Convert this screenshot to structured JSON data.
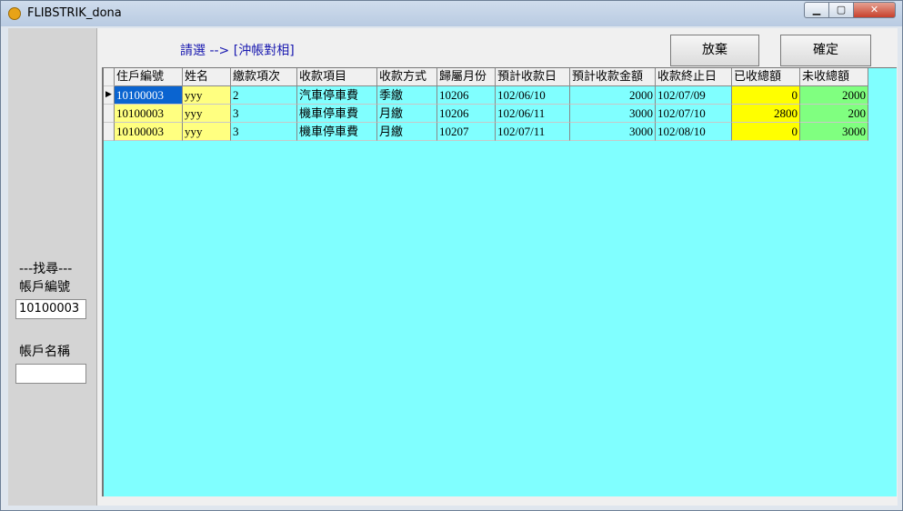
{
  "window": {
    "title": "FLIBSTRIK_dona",
    "min_glyph": "▁",
    "max_glyph": "▢",
    "close_glyph": "✕"
  },
  "search": {
    "heading": "---找尋---",
    "account_no_label": "帳戶編號",
    "account_no_value": "10100003",
    "account_name_label": "帳戶名稱",
    "account_name_value": ""
  },
  "main": {
    "prompt": "請選 --> [沖帳對相]",
    "cancel_label": "放棄",
    "confirm_label": "確定"
  },
  "grid": {
    "current_row_marker": "▶",
    "headers": [
      "住戶編號",
      "姓名",
      "繳款項次",
      "收款項目",
      "收款方式",
      "歸屬月份",
      "預計收款日",
      "預計收款金額",
      "收款終止日",
      "已收總額",
      "未收總額"
    ],
    "rows": [
      [
        "10100003",
        "yyy",
        "2",
        "汽車停車費",
        "季繳",
        "10206",
        "102/06/10",
        "2000",
        "102/07/09",
        "0",
        "2000"
      ],
      [
        "10100003",
        "yyy",
        "3",
        "機車停車費",
        "月繳",
        "10206",
        "102/06/11",
        "3000",
        "102/07/10",
        "2800",
        "200"
      ],
      [
        "10100003",
        "yyy",
        "3",
        "機車停車費",
        "月繳",
        "10207",
        "102/07/11",
        "3000",
        "102/08/10",
        "0",
        "3000"
      ]
    ]
  },
  "colors": {
    "grid_background": "#80ffff",
    "name_column": "#ffff80",
    "collected_column": "#ffff00",
    "uncollected_column": "#80ff80",
    "selection": "#0a64d0"
  }
}
